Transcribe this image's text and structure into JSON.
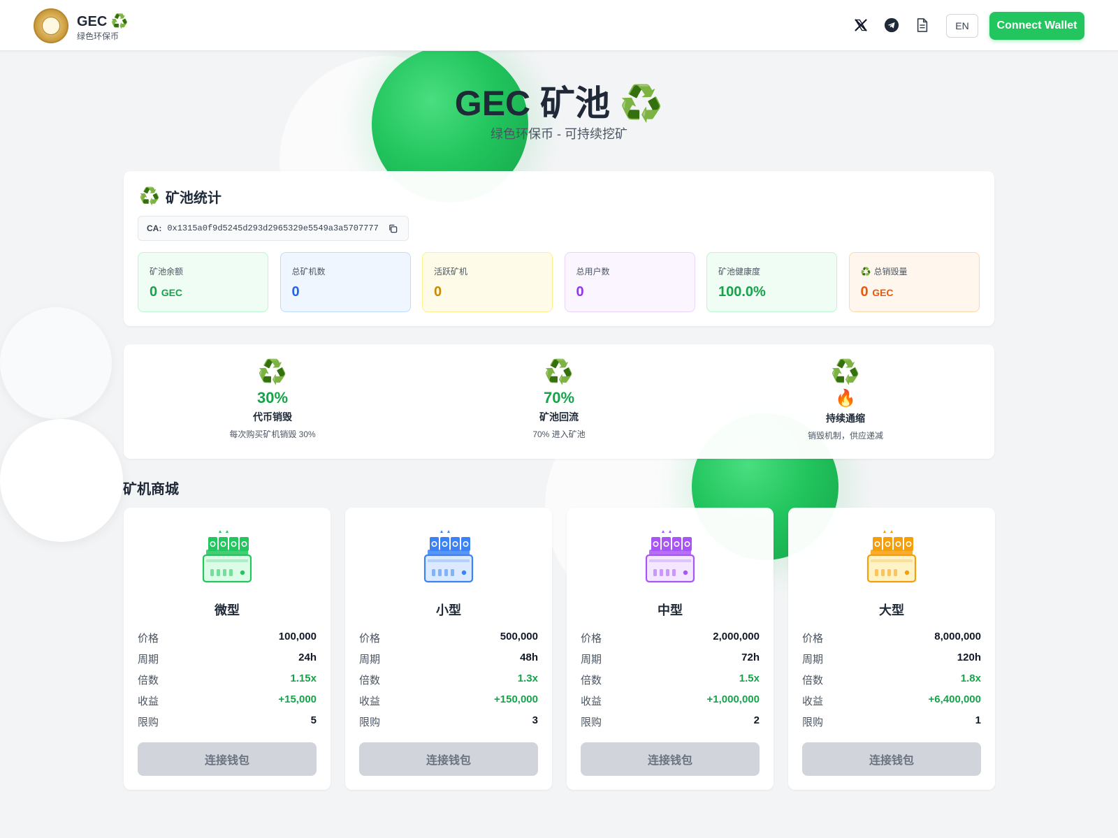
{
  "header": {
    "brand_name": "GEC",
    "brand_emoji": "♻️",
    "brand_sub": "绿色环保币",
    "icons": [
      "x-icon",
      "telegram-icon",
      "document-icon"
    ],
    "lang_label": "EN",
    "wallet_label": "Connect Wallet"
  },
  "hero": {
    "title": "GEC 矿池 ♻️",
    "subtitle": "绿色环保币 - 可持续挖矿"
  },
  "stats": {
    "title": "矿池统计",
    "ca_label": "CA:",
    "ca_value": "0x1315a0f9d5245d293d2965329e5549a3a5707777",
    "cards": [
      {
        "label": "矿池余额",
        "value": "0",
        "unit": "GEC",
        "color": "#16a34a",
        "bg": "#f0fdf4",
        "border": "#bbf7d0"
      },
      {
        "label": "总矿机数",
        "value": "0",
        "unit": "",
        "color": "#2563eb",
        "bg": "#eff6ff",
        "border": "#bfdbfe"
      },
      {
        "label": "活跃矿机",
        "value": "0",
        "unit": "",
        "color": "#ca8a04",
        "bg": "#fefce8",
        "border": "#fef08a"
      },
      {
        "label": "总用户数",
        "value": "0",
        "unit": "",
        "color": "#9333ea",
        "bg": "#faf5ff",
        "border": "#e9d5ff"
      },
      {
        "label": "矿池健康度",
        "value": "100.0%",
        "unit": "",
        "color": "#16a34a",
        "bg": "#f0fdf4",
        "border": "#bbf7d0"
      },
      {
        "label": "总销毁量",
        "value": "0",
        "unit": "GEC",
        "color": "#ea580c",
        "bg": "#fff7ed",
        "border": "#fed7aa",
        "emoji": "♻️"
      }
    ]
  },
  "mechanics": [
    {
      "icon": "♻️",
      "value": "30%",
      "title": "代币销毁",
      "desc": "每次购买矿机销毁 30%"
    },
    {
      "icon": "♻️",
      "value": "70%",
      "title": "矿池回流",
      "desc": "70% 进入矿池"
    },
    {
      "icon": "♻️",
      "value": "🔥",
      "title": "持续通缩",
      "desc": "销毁机制，供应递减"
    }
  ],
  "shop": {
    "title": "矿机商城",
    "row_labels": {
      "price": "价格",
      "period": "周期",
      "multiplier": "倍数",
      "profit": "收益",
      "limit": "限购"
    },
    "button_label": "连接钱包",
    "miners": [
      {
        "name": "微型",
        "price": "100,000",
        "period": "24h",
        "multiplier": "1.15x",
        "profit": "+15,000",
        "limit": "5",
        "color": "#22c55e",
        "light": "#dcfce7"
      },
      {
        "name": "小型",
        "price": "500,000",
        "period": "48h",
        "multiplier": "1.3x",
        "profit": "+150,000",
        "limit": "3",
        "color": "#3b82f6",
        "light": "#dbeafe"
      },
      {
        "name": "中型",
        "price": "2,000,000",
        "period": "72h",
        "multiplier": "1.5x",
        "profit": "+1,000,000",
        "limit": "2",
        "color": "#a855f7",
        "light": "#f3e8ff"
      },
      {
        "name": "大型",
        "price": "8,000,000",
        "period": "120h",
        "multiplier": "1.8x",
        "profit": "+6,400,000",
        "limit": "1",
        "color": "#f59e0b",
        "light": "#fef3c7"
      }
    ]
  }
}
